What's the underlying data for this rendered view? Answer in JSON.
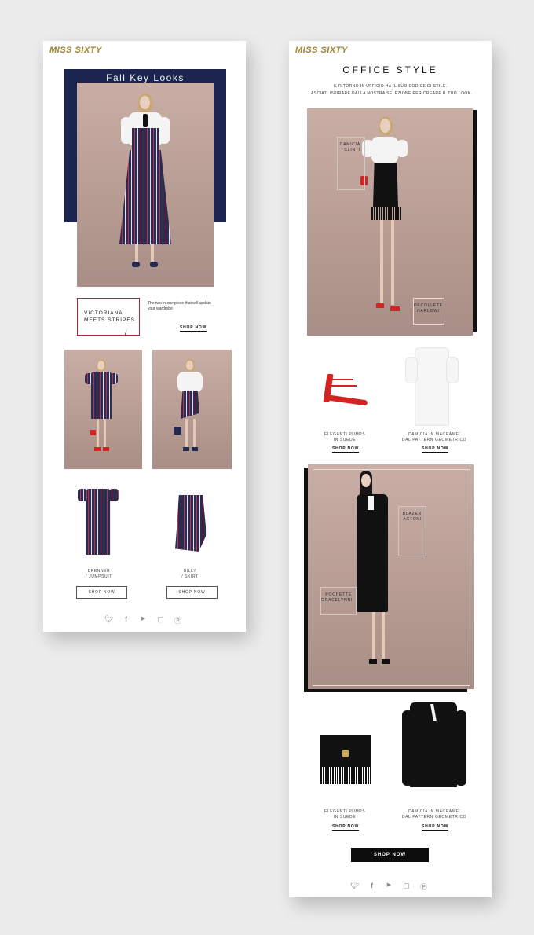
{
  "left": {
    "logo": "MISS SIXTY",
    "hero_title": "Fall Key Looks",
    "promo": {
      "title_line1": "VICTORIANA",
      "title_line2": "MEETS STRIPES",
      "slash": "/",
      "description": "The two in one piece that will update your wardrobe",
      "shop_link": "SHOP NOW"
    },
    "products": [
      {
        "name_line1": "BRENNER",
        "name_line2": "/ JUMPSUIT",
        "button": "SHOP NOW"
      },
      {
        "name_line1": "BILLY",
        "name_line2": "/ SKIRT",
        "button": "SHOP NOW"
      }
    ]
  },
  "right": {
    "logo": "MISS SIXTY",
    "title": "OFFICE STYLE",
    "subtitle_line1": "IL RITORNO IN UFFICIO HA IL SUO CODICE DI STILE.",
    "subtitle_line2": "LASCIATI ISPIRARE DALLA NOSTRA SELEZIONE PER CREARE IL TUO LOOK.",
    "look1_labels": [
      {
        "line1": "CAMICIA",
        "line2": "CLINTI"
      },
      {
        "line1": "DECOLLETE",
        "line2": "HARLOWI"
      }
    ],
    "look1_products": [
      {
        "name_line1": "ELEGANTI PUMPS",
        "name_line2": "IN SUEDE",
        "shop": "SHOP NOW"
      },
      {
        "name_line1": "CAMICIA IN MACRAME'",
        "name_line2": "DAL PATTERN GEOMETRICO",
        "shop": "SHOP NOW"
      }
    ],
    "look2_labels": [
      {
        "line1": "BLAZER",
        "line2": "ACTONI"
      },
      {
        "line1": "POCHETTE",
        "line2": "GRACELYNNI"
      }
    ],
    "look2_products": [
      {
        "name_line1": "ELEGANTI PUMPS",
        "name_line2": "IN SUEDE",
        "shop": "SHOP NOW"
      },
      {
        "name_line1": "CAMICIA IN MACRAME'",
        "name_line2": "DAL PATTERN GEOMETRICO",
        "shop": "SHOP NOW"
      }
    ],
    "cta": "SHOP NOW"
  },
  "social_icons": [
    "twitter-icon",
    "facebook-icon",
    "youtube-icon",
    "instagram-icon",
    "pinterest-icon"
  ],
  "colors": {
    "logo_gold": "#a08a3c",
    "navy": "#1c2550",
    "promo_border": "#b3243b"
  }
}
